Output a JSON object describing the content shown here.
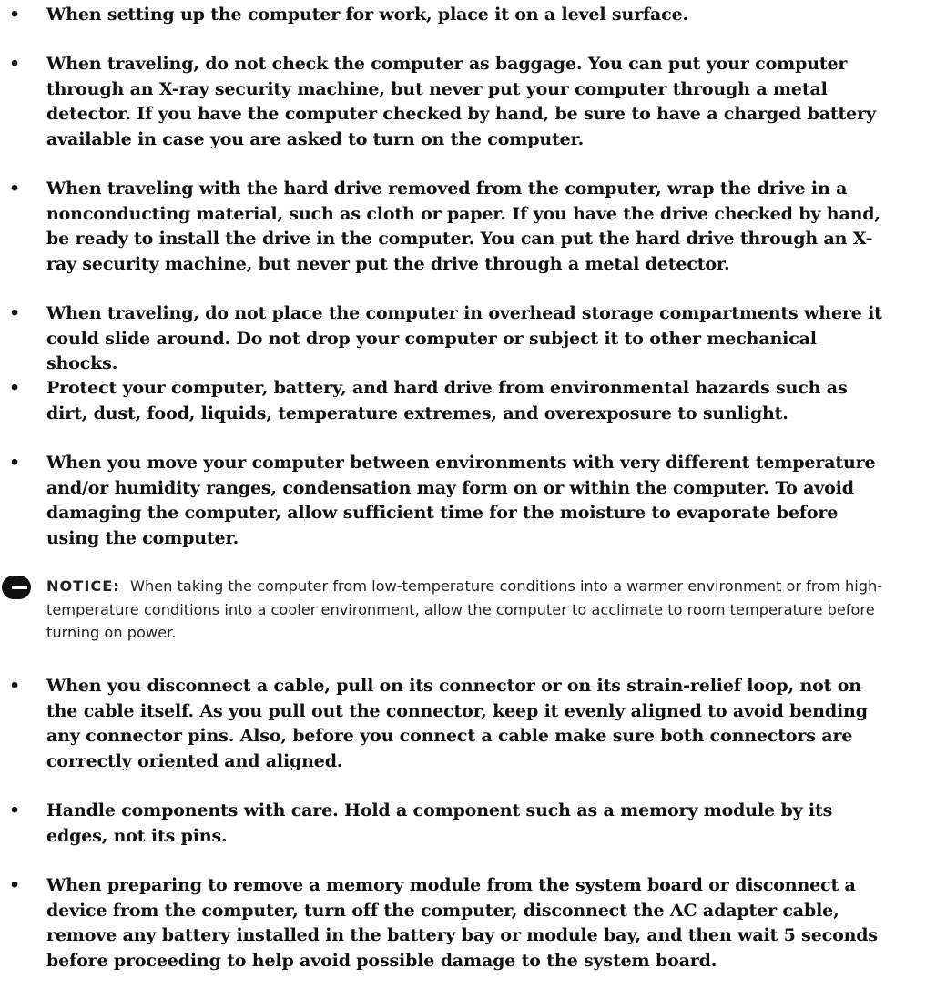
{
  "list_a": [
    {
      "bullet": "•",
      "text": "When setting up the computer for work, place it on a level surface."
    },
    {
      "bullet": "•",
      "text": "When traveling, do not check the computer as baggage. You can put your computer through an X-ray security machine, but never put your computer through a metal detector. If you have the computer checked by hand, be sure to have a charged battery available in case you are asked to turn on the computer."
    },
    {
      "bullet": "•",
      "text": "When traveling with the hard drive removed from the computer, wrap the drive in a nonconducting material, such as cloth or paper. If you have the drive checked by hand, be ready to install the drive in the computer. You can put the hard drive through an X-ray security machine, but never put the drive through a metal detector."
    },
    {
      "bullet": "•",
      "text": "When traveling, do not place the computer in overhead storage compartments where it could slide around. Do not drop your computer or subject it to other mechanical shocks."
    },
    {
      "bullet": "•",
      "text": "Protect your computer, battery, and hard drive from environmental hazards such as dirt, dust, food, liquids, temperature extremes, and overexposure to sunlight."
    },
    {
      "bullet": "•",
      "text": "When you move your computer between environments with very different temperature and/or humidity ranges, condensation may form on or within the computer. To avoid damaging the computer, allow sufficient time for the moisture to evaporate before using the computer."
    }
  ],
  "notice": {
    "icon": "notice-icon",
    "label": "NOTICE:",
    "text": "When taking the computer from low-temperature conditions into a warmer environment or from high-temperature conditions into a cooler environment, allow the computer to acclimate to room temperature before turning on power."
  },
  "list_b": [
    {
      "bullet": "•",
      "text": "When you disconnect a cable, pull on its connector or on its strain-relief loop, not on the cable itself. As you pull out the connector, keep it evenly aligned to avoid bending any connector pins. Also, before you connect a cable make sure both connectors are correctly oriented and aligned."
    },
    {
      "bullet": "•",
      "text": "Handle components with care. Hold a component such as a memory module by its edges, not its pins."
    },
    {
      "bullet": "•",
      "text": "When preparing to remove a memory module from the system board or disconnect a device from the computer, turn off the computer, disconnect the AC adapter cable, remove any battery installed in the battery bay or module bay, and then wait 5 seconds before proceeding to help avoid possible damage to the system board."
    }
  ]
}
